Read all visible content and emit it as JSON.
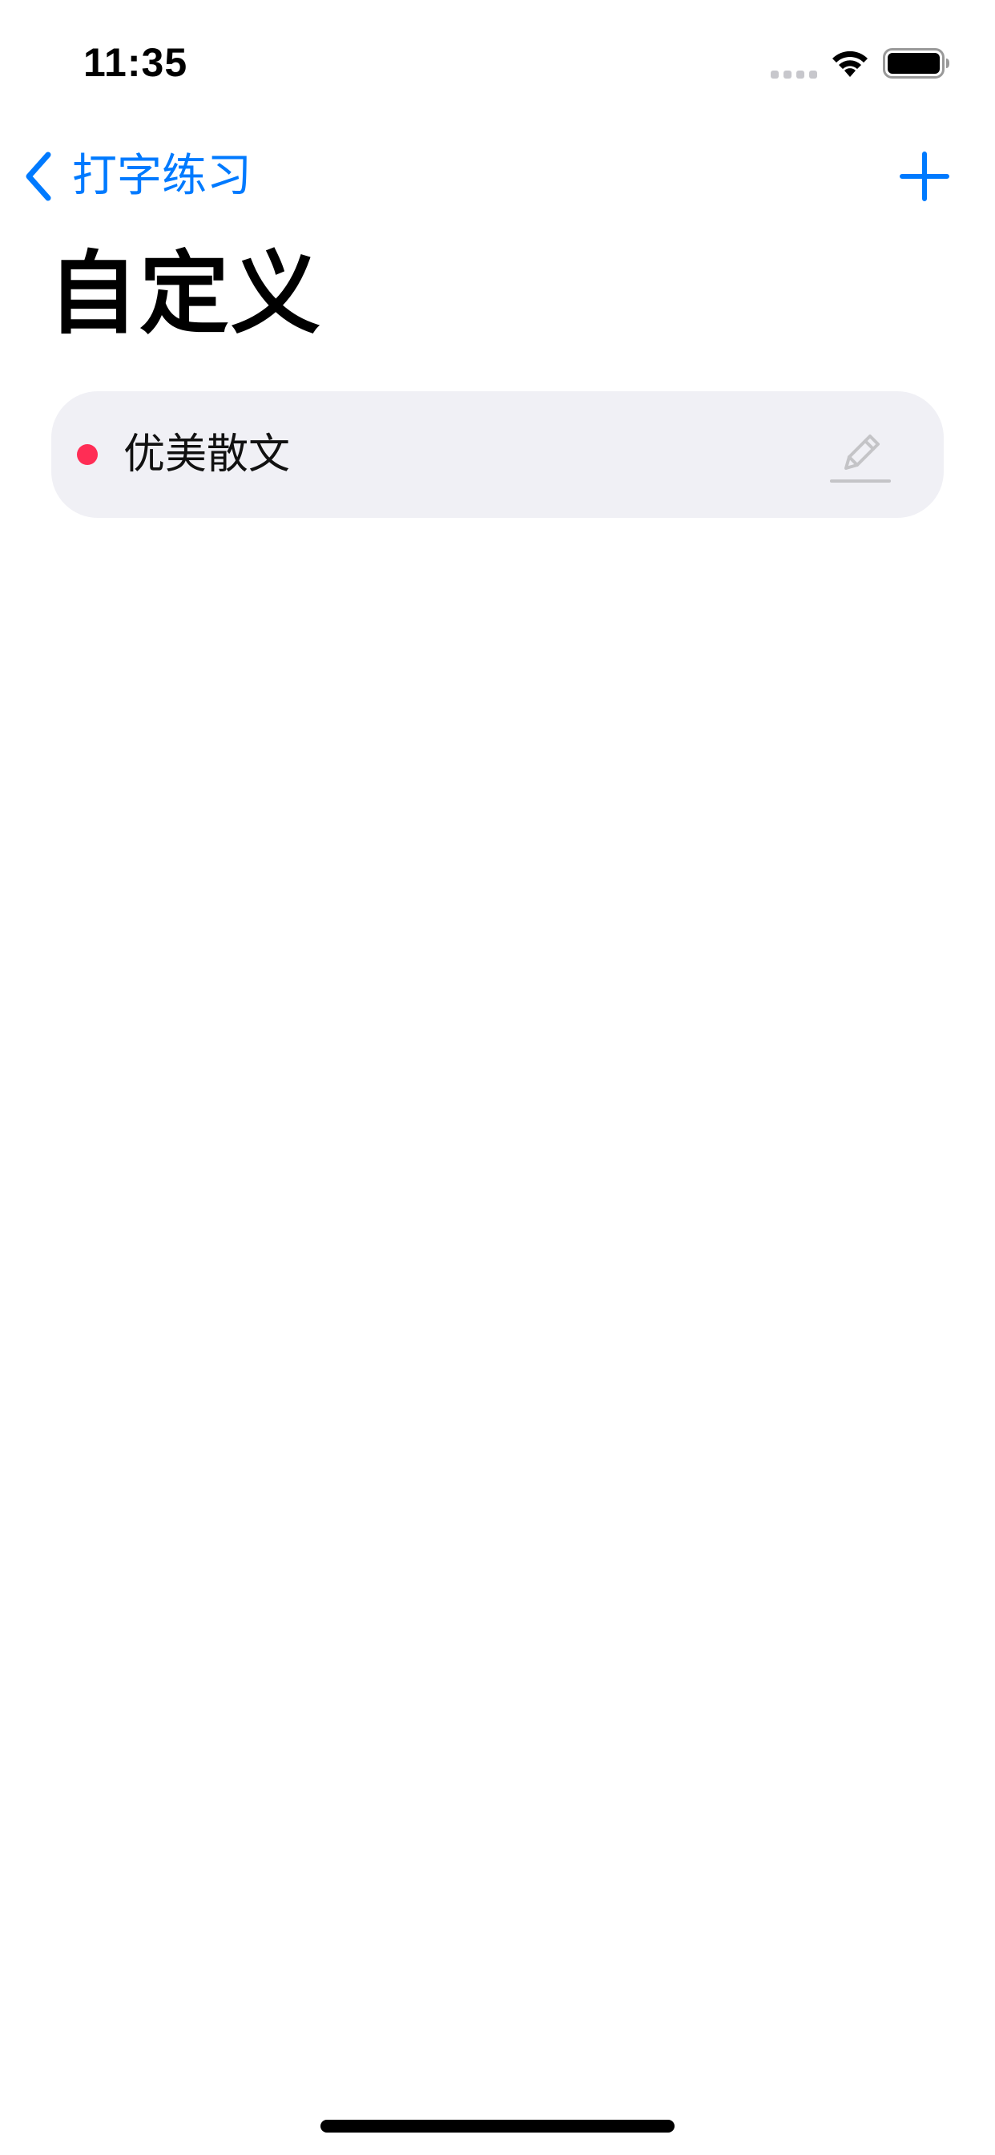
{
  "status_bar": {
    "time": "11:35",
    "icons": [
      "cellular-signal-icon",
      "wifi-icon",
      "battery-icon"
    ]
  },
  "nav": {
    "back_label": "打字练习",
    "back_icon": "chevron-left-icon",
    "add_icon": "plus-icon"
  },
  "page": {
    "title": "自定义"
  },
  "list": {
    "items": [
      {
        "label": "优美散文",
        "dot_color": "#ff2d55",
        "action_icon": "pencil-edit-icon"
      }
    ]
  },
  "colors": {
    "accent": "#007aff",
    "card_background": "#f0f0f5",
    "dot": "#ff2d55",
    "edit_icon": "#c4c4c7"
  }
}
